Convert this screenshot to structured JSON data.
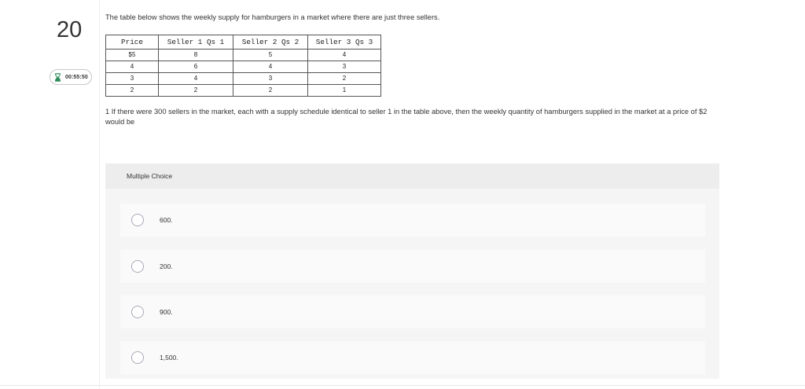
{
  "question": {
    "number": "20",
    "timer": "00:55:50",
    "intro": "The table below shows the weekly supply for hamburgers in a market where there are just three sellers.",
    "table": {
      "headers": [
        "Price",
        "Seller 1 Qs 1",
        "Seller 2 Qs 2",
        "Seller 3 Qs 3"
      ],
      "rows": [
        [
          "$5",
          "8",
          "5",
          "4"
        ],
        [
          "4",
          "6",
          "4",
          "3"
        ],
        [
          "3",
          "4",
          "3",
          "2"
        ],
        [
          "2",
          "2",
          "2",
          "1"
        ]
      ]
    },
    "prompt": "1 If there were 300 sellers in the market, each with a supply schedule identical to seller 1 in the table above, then the weekly quantity of hamburgers supplied in the market at a price of $2 would be"
  },
  "multiple_choice": {
    "label": "Multiple Choice",
    "options": [
      {
        "label": "600."
      },
      {
        "label": "200."
      },
      {
        "label": "900."
      },
      {
        "label": "1,500."
      }
    ]
  },
  "icons": {
    "timer": "hourglass-icon",
    "option": "radio-button"
  },
  "colors": {
    "panel_bg": "#f5f5f5",
    "header_bg": "#ededed",
    "option_bg": "#fafafa",
    "timer_icon": "#2e8b57"
  }
}
